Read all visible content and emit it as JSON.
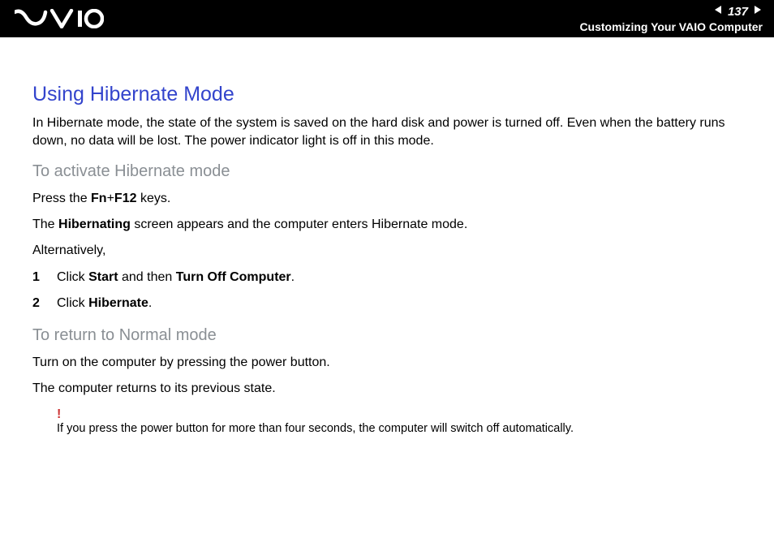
{
  "header": {
    "page_number": "137",
    "section_title": "Customizing Your VAIO Computer"
  },
  "content": {
    "heading": "Using Hibernate Mode",
    "intro": "In Hibernate mode, the state of the system is saved on the hard disk and power is turned off. Even when the battery runs down, no data will be lost. The power indicator light is off in this mode.",
    "sub1": "To activate Hibernate mode",
    "press_pre": "Press the ",
    "press_key1": "Fn",
    "press_plus": "+",
    "press_key2": "F12",
    "press_post": " keys.",
    "hib_pre": "The ",
    "hib_bold": "Hibernating",
    "hib_post": " screen appears and the computer enters Hibernate mode.",
    "alt": "Alternatively,",
    "step1_num": "1",
    "step1_pre": "Click ",
    "step1_b1": "Start",
    "step1_mid": " and then ",
    "step1_b2": "Turn Off Computer",
    "step1_post": ".",
    "step2_num": "2",
    "step2_pre": "Click ",
    "step2_b1": "Hibernate",
    "step2_post": ".",
    "sub2": "To return to Normal mode",
    "return1": "Turn on the computer by pressing the power button.",
    "return2": "The computer returns to its previous state.",
    "note_mark": "!",
    "note_text": "If you press the power button for more than four seconds, the computer will switch off automatically."
  }
}
